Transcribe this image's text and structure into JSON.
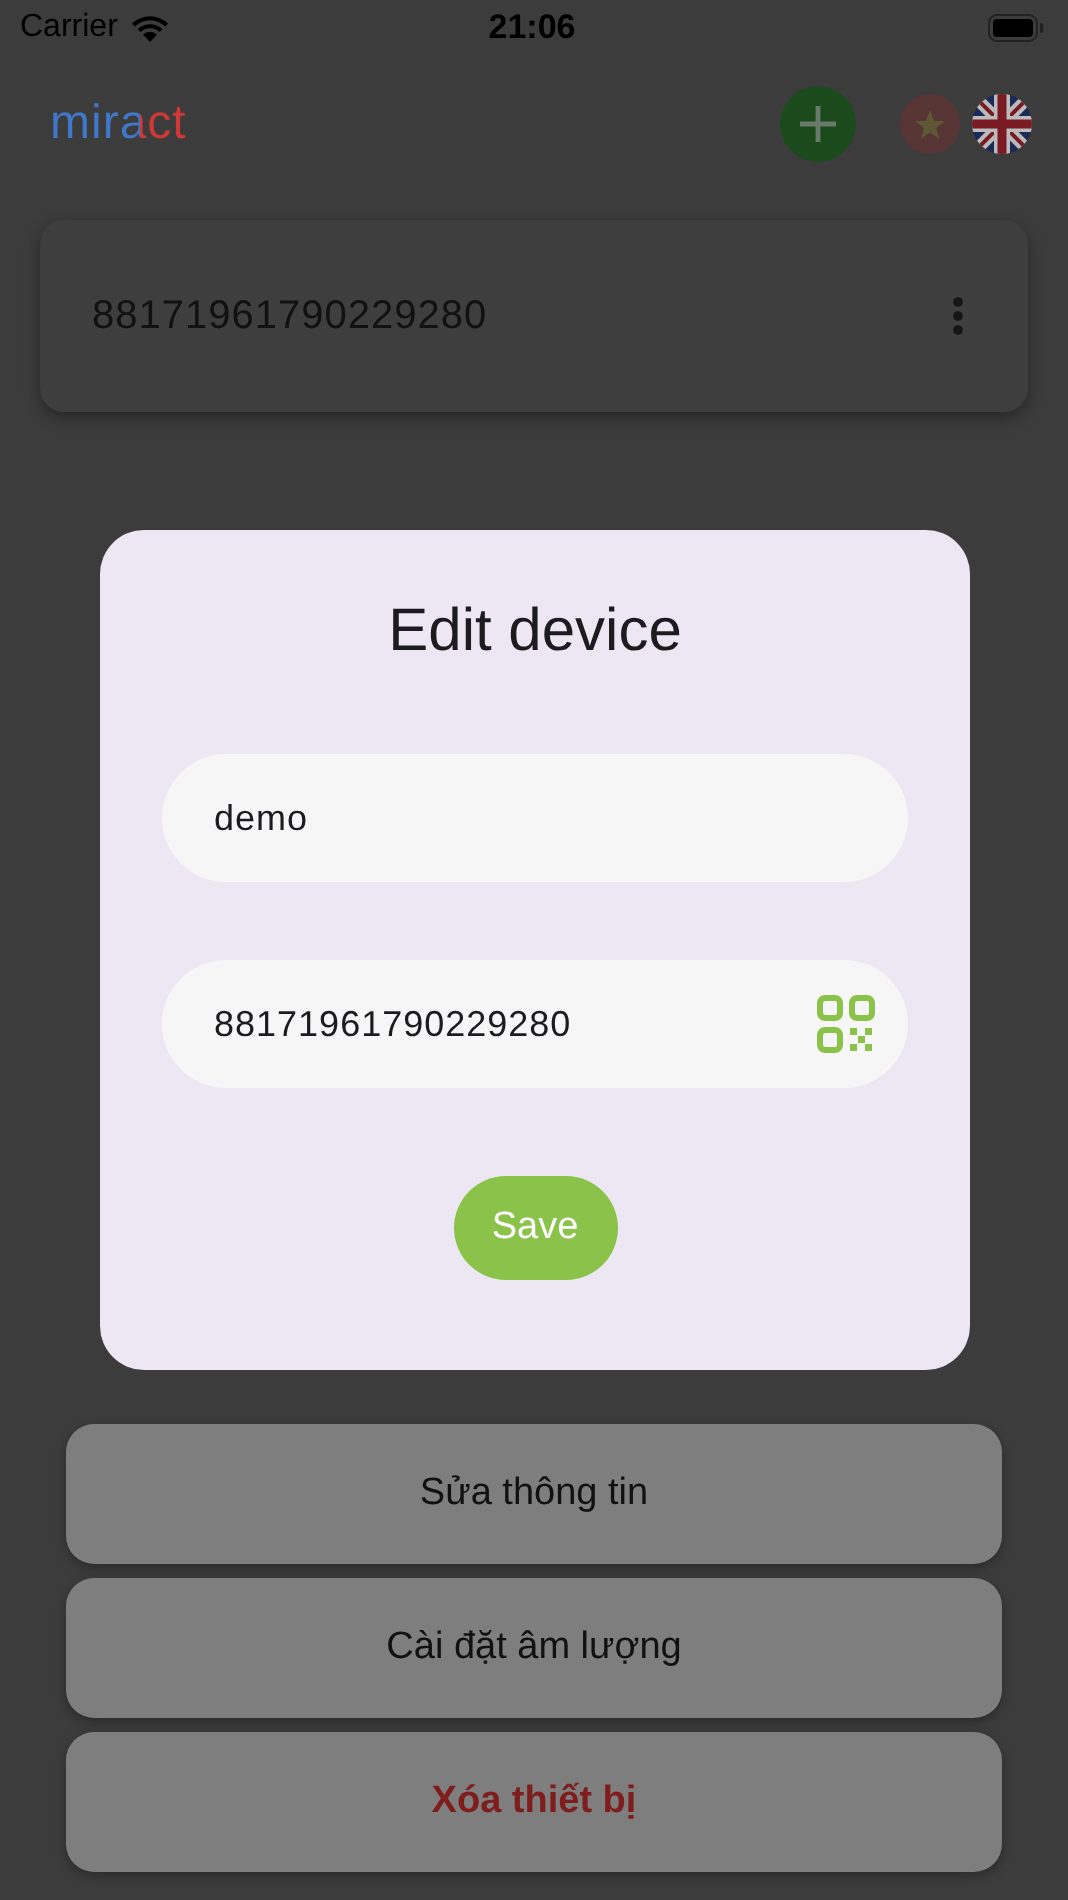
{
  "status_bar": {
    "carrier": "Carrier",
    "time": "21:06"
  },
  "header": {
    "logo": "miract",
    "languages": [
      {
        "kind": "vi",
        "selected": false
      },
      {
        "kind": "en",
        "selected": true
      }
    ]
  },
  "devices": [
    {
      "code": "88171961790229280"
    }
  ],
  "action_sheet": {
    "actions": [
      {
        "label": "Sửa thông tin",
        "kind": "normal"
      },
      {
        "label": "Cài đặt âm lượng",
        "kind": "normal"
      },
      {
        "label": "Xóa thiết bị",
        "kind": "destructive"
      }
    ]
  },
  "dialog": {
    "title": "Edit device",
    "name_field": {
      "value": "demo"
    },
    "code_field": {
      "value": "88171961790229280"
    },
    "save_button": "Save"
  }
}
